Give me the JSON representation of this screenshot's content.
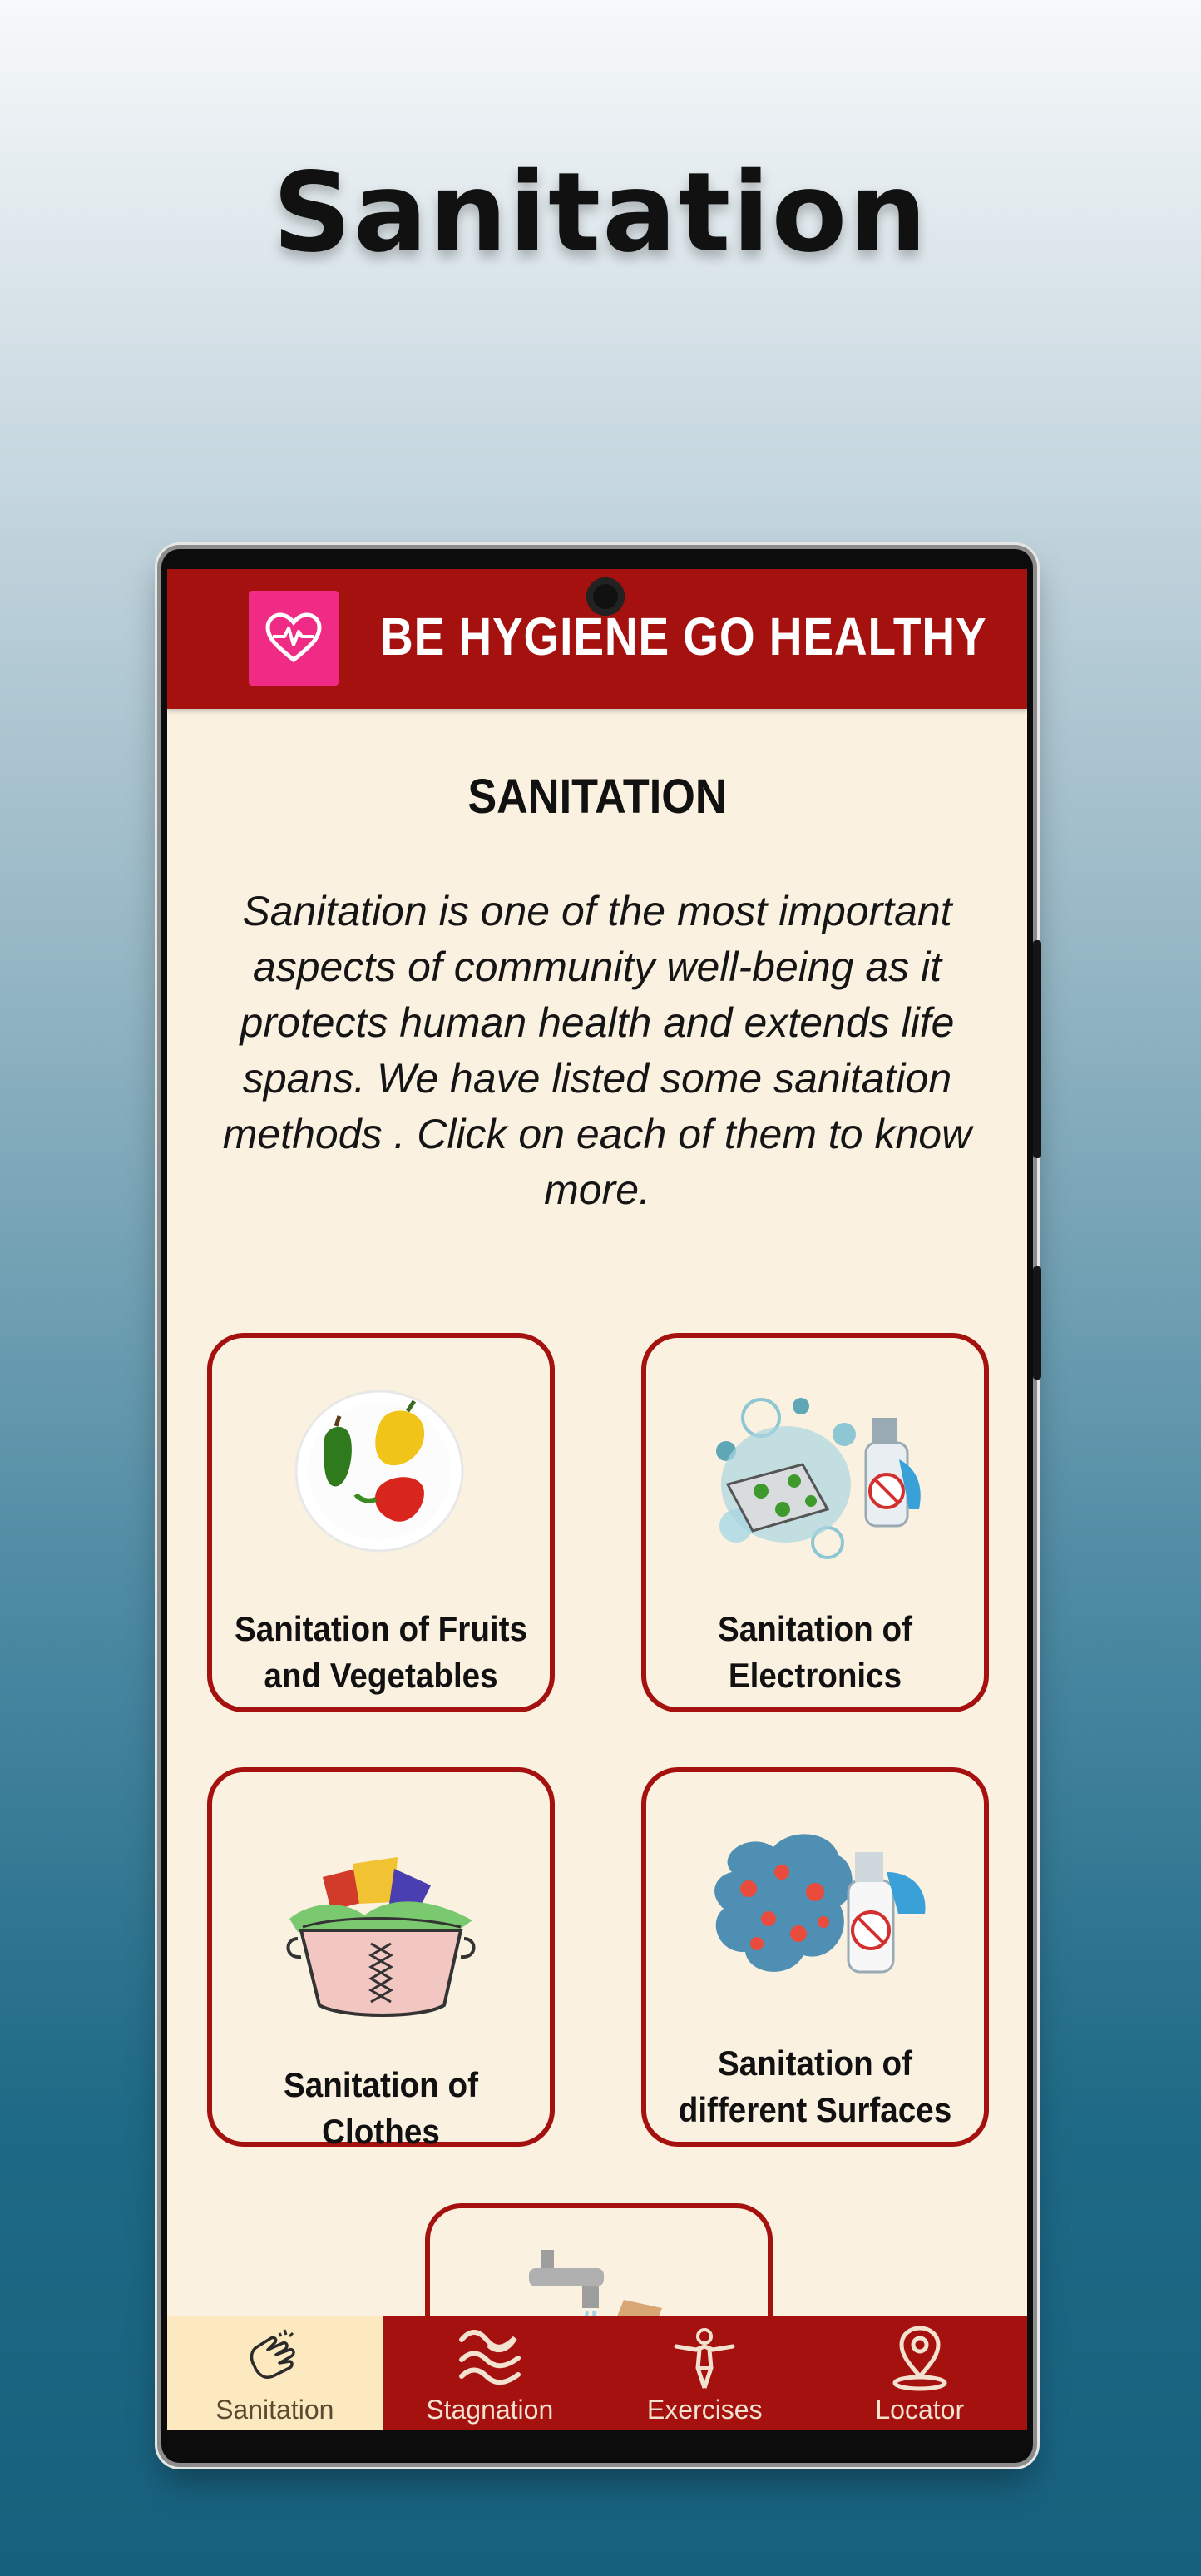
{
  "hero": {
    "title": "Sanitation"
  },
  "app_bar": {
    "title": "BE HYGIENE GO HEALTHY",
    "logo_icon": "heart-pulse-icon"
  },
  "page": {
    "heading": "SANITATION",
    "intro": "Sanitation is one of the most important aspects of community well-being as it protects human health and extends life spans. We have listed some sanitation methods . Click on each of them to know more."
  },
  "cards": [
    {
      "label": "Sanitation of Fruits and Vegetables",
      "icon": "peppers-bowl-icon"
    },
    {
      "label": "Sanitation of Electronics",
      "icon": "electronics-spray-icon"
    },
    {
      "label": "Sanitation of Clothes",
      "icon": "laundry-basket-icon"
    },
    {
      "label": "Sanitation of different Surfaces",
      "icon": "surface-spray-icon"
    },
    {
      "label": "",
      "icon": "faucet-icon"
    }
  ],
  "bottom_nav": [
    {
      "label": "Sanitation",
      "icon": "hands-washing-icon",
      "active": true
    },
    {
      "label": "Stagnation",
      "icon": "water-waves-icon",
      "active": false
    },
    {
      "label": "Exercises",
      "icon": "exercise-figure-icon",
      "active": false
    },
    {
      "label": "Locator",
      "icon": "location-pin-icon",
      "active": false
    }
  ],
  "colors": {
    "primary": "#a4110e",
    "background": "#fbf1e1",
    "logo": "#f02b86",
    "active_tab": "#fde9c0"
  }
}
